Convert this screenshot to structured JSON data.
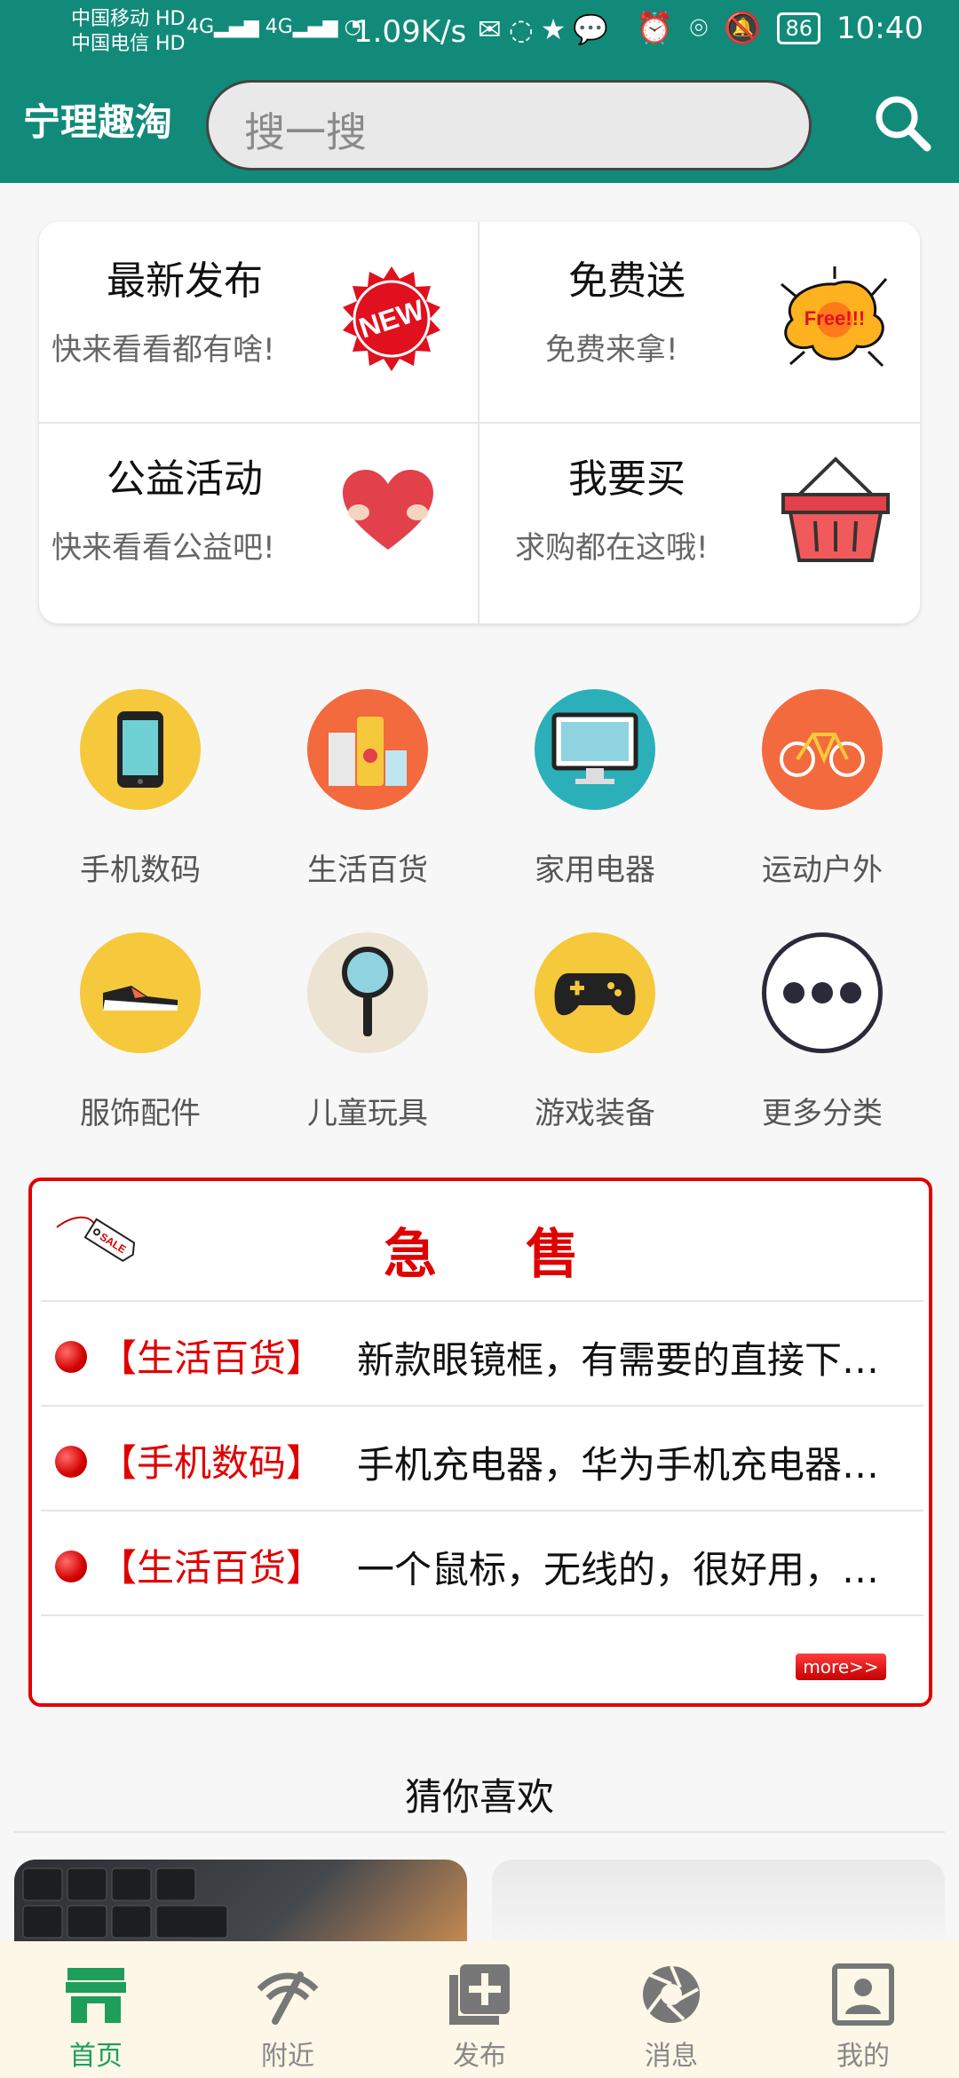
{
  "status_bar": {
    "carrier_1": "中国移动",
    "carrier_2": "中国电信",
    "hd": "HD",
    "net": "4G",
    "speed": "1.09K/s",
    "battery": "86",
    "time": "10:40"
  },
  "header": {
    "app_name": "宁理趣淘",
    "search_placeholder": "搜一搜"
  },
  "features": [
    {
      "title": "最新发布",
      "subtitle": "快来看看都有啥!",
      "icon": "new-badge-icon"
    },
    {
      "title": "免费送",
      "subtitle": "免费来拿!",
      "icon": "free-burst-icon"
    },
    {
      "title": "公益活动",
      "subtitle": "快来看看公益吧!",
      "icon": "heart-hands-icon"
    },
    {
      "title": "我要买",
      "subtitle": "求购都在这哦!",
      "icon": "basket-icon"
    }
  ],
  "categories": [
    {
      "label": "手机数码",
      "icon": "phone-icon",
      "color": "#f6c83b"
    },
    {
      "label": "生活百货",
      "icon": "groceries-icon",
      "color": "#f26a3d"
    },
    {
      "label": "家用电器",
      "icon": "monitor-icon",
      "color": "#2bb0b9"
    },
    {
      "label": "运动户外",
      "icon": "bicycle-icon",
      "color": "#f26a3d"
    },
    {
      "label": "服饰配件",
      "icon": "sneaker-icon",
      "color": "#f6c83b"
    },
    {
      "label": "儿童玩具",
      "icon": "magnifier-icon",
      "color": "#ece3d2"
    },
    {
      "label": "游戏装备",
      "icon": "gamepad-icon",
      "color": "#f6c83b"
    },
    {
      "label": "更多分类",
      "icon": "more-dots-icon",
      "color": "#ffffff"
    }
  ],
  "flash_sale": {
    "title": "急售",
    "items": [
      {
        "category": "【生活百货】",
        "text": "新款眼镜框，有需要的直接下单，价格美丽"
      },
      {
        "category": "【手机数码】",
        "text": "手机充电器，华为手机充电器，九成新"
      },
      {
        "category": "【生活百货】",
        "text": "一个鼠标，无线的，很好用，便宜出"
      }
    ],
    "more_label": "more>>"
  },
  "guess_title": "猜你喜欢",
  "bottom_nav": [
    {
      "label": "首页",
      "icon": "shop-icon",
      "active": true
    },
    {
      "label": "附近",
      "icon": "location-signal-icon",
      "active": false
    },
    {
      "label": "发布",
      "icon": "add-square-icon",
      "active": false
    },
    {
      "label": "消息",
      "icon": "aperture-icon",
      "active": false
    },
    {
      "label": "我的",
      "icon": "profile-card-icon",
      "active": false
    }
  ]
}
